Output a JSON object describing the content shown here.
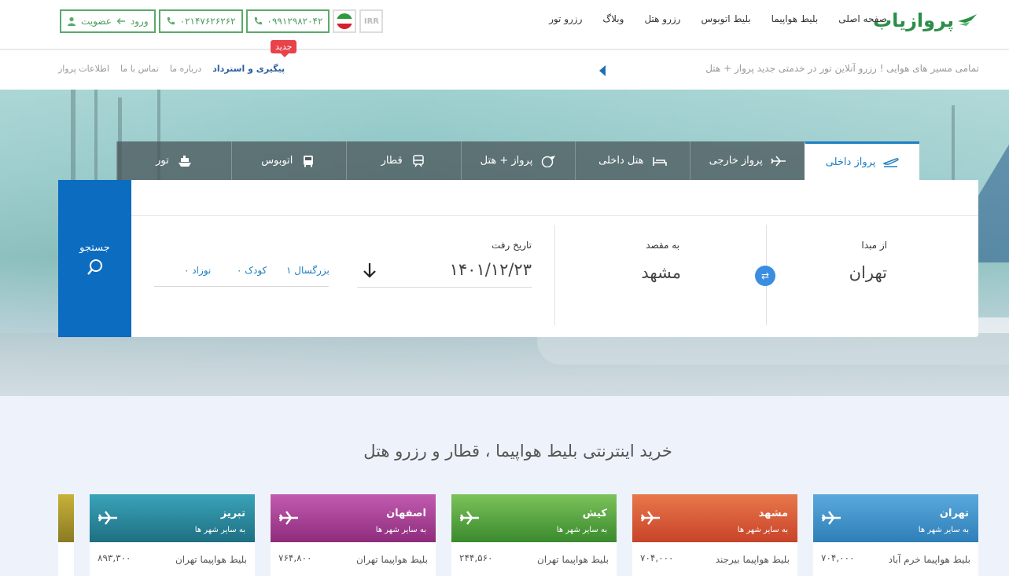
{
  "header": {
    "logo_text": "پروازیاب",
    "nav": [
      "صفحه اصلی",
      "بلیط هواپیما",
      "بلیط اتوبوس",
      "رزرو هتل",
      "وبلاگ",
      "رزرو تور"
    ],
    "account_label": "ورود ← عضویت",
    "login_label": "ورود",
    "signup_label": "عضویت",
    "phone_1": "۰۲۱۴۷۶۲۶۲۶۲",
    "phone_2": "۰۹۹۱۲۹۸۲۰۴۲",
    "currency": "IRR"
  },
  "subbar": {
    "ticker": "تمامی مسیر های هوایی ! رزرو آنلاین تور در خدمتی جدید پرواز + هتل",
    "links": [
      "پیگیری و استرداد",
      "درباره ما",
      "تماس با ما",
      "اطلاعات پرواز"
    ],
    "new_badge": "جدید"
  },
  "tabs": [
    {
      "label": "پرواز داخلی",
      "icon": "plane-takeoff-icon",
      "active": true
    },
    {
      "label": "پرواز خارجی",
      "icon": "plane-icon",
      "active": false
    },
    {
      "label": "هتل داخلی",
      "icon": "bed-icon",
      "active": false
    },
    {
      "label": "پرواز + هتل",
      "icon": "globe-plane-icon",
      "active": false
    },
    {
      "label": "قطار",
      "icon": "train-icon",
      "active": false
    },
    {
      "label": "اتوبوس",
      "icon": "bus-icon",
      "active": false
    },
    {
      "label": "تور",
      "icon": "ship-icon",
      "active": false
    }
  ],
  "search": {
    "origin_label": "از مبدا",
    "origin_value": "تهران",
    "destination_label": "به مقصد",
    "destination_value": "مشهد",
    "date_label": "تاریخ رفت",
    "date_value": "۱۴۰۱/۱۲/۲۳",
    "adults": "۱ بزرگسال",
    "children": "۰ کودک",
    "infants": "۰ نوزاد",
    "search_label": "جستجو"
  },
  "section_title": "خرید اینترنتی بلیط هواپیما ، قطار و رزرو هتل",
  "cards": [
    {
      "city": "تهران",
      "sub": "به سایر شهر ها",
      "desc": "بلیط هواپیما خرم آباد",
      "price": "۷۰۴,۰۰۰",
      "color": "#3a8fc8"
    },
    {
      "city": "مشهد",
      "sub": "به سایر شهر ها",
      "desc": "بلیط هواپیما بیرجند",
      "price": "۷۰۴,۰۰۰",
      "color": "#d9592e"
    },
    {
      "city": "کیش",
      "sub": "به سایر شهر ها",
      "desc": "بلیط هواپیما تهران",
      "price": "۲۴۴,۵۶۰",
      "color": "#4a9d3a"
    },
    {
      "city": "اصفهان",
      "sub": "به سایر شهر ها",
      "desc": "بلیط هواپیما تهران",
      "price": "۷۶۴,۸۰۰",
      "color": "#a6398f"
    },
    {
      "city": "تبریز",
      "sub": "به سایر شهر ها",
      "desc": "بلیط هواپیما تهران",
      "price": "۸۹۳,۳۰۰",
      "color": "#2f8ea3"
    }
  ]
}
